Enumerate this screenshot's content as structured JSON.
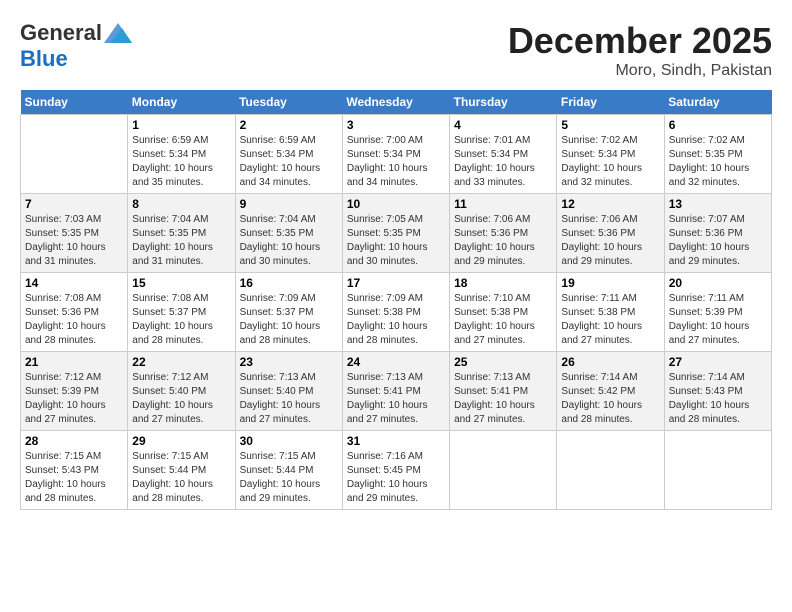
{
  "logo": {
    "general": "General",
    "blue": "Blue"
  },
  "title": "December 2025",
  "subtitle": "Moro, Sindh, Pakistan",
  "days_of_week": [
    "Sunday",
    "Monday",
    "Tuesday",
    "Wednesday",
    "Thursday",
    "Friday",
    "Saturday"
  ],
  "weeks": [
    [
      {
        "day": "",
        "sunrise": "",
        "sunset": "",
        "daylight": ""
      },
      {
        "day": "1",
        "sunrise": "Sunrise: 6:59 AM",
        "sunset": "Sunset: 5:34 PM",
        "daylight": "Daylight: 10 hours and 35 minutes."
      },
      {
        "day": "2",
        "sunrise": "Sunrise: 6:59 AM",
        "sunset": "Sunset: 5:34 PM",
        "daylight": "Daylight: 10 hours and 34 minutes."
      },
      {
        "day": "3",
        "sunrise": "Sunrise: 7:00 AM",
        "sunset": "Sunset: 5:34 PM",
        "daylight": "Daylight: 10 hours and 34 minutes."
      },
      {
        "day": "4",
        "sunrise": "Sunrise: 7:01 AM",
        "sunset": "Sunset: 5:34 PM",
        "daylight": "Daylight: 10 hours and 33 minutes."
      },
      {
        "day": "5",
        "sunrise": "Sunrise: 7:02 AM",
        "sunset": "Sunset: 5:34 PM",
        "daylight": "Daylight: 10 hours and 32 minutes."
      },
      {
        "day": "6",
        "sunrise": "Sunrise: 7:02 AM",
        "sunset": "Sunset: 5:35 PM",
        "daylight": "Daylight: 10 hours and 32 minutes."
      }
    ],
    [
      {
        "day": "7",
        "sunrise": "Sunrise: 7:03 AM",
        "sunset": "Sunset: 5:35 PM",
        "daylight": "Daylight: 10 hours and 31 minutes."
      },
      {
        "day": "8",
        "sunrise": "Sunrise: 7:04 AM",
        "sunset": "Sunset: 5:35 PM",
        "daylight": "Daylight: 10 hours and 31 minutes."
      },
      {
        "day": "9",
        "sunrise": "Sunrise: 7:04 AM",
        "sunset": "Sunset: 5:35 PM",
        "daylight": "Daylight: 10 hours and 30 minutes."
      },
      {
        "day": "10",
        "sunrise": "Sunrise: 7:05 AM",
        "sunset": "Sunset: 5:35 PM",
        "daylight": "Daylight: 10 hours and 30 minutes."
      },
      {
        "day": "11",
        "sunrise": "Sunrise: 7:06 AM",
        "sunset": "Sunset: 5:36 PM",
        "daylight": "Daylight: 10 hours and 29 minutes."
      },
      {
        "day": "12",
        "sunrise": "Sunrise: 7:06 AM",
        "sunset": "Sunset: 5:36 PM",
        "daylight": "Daylight: 10 hours and 29 minutes."
      },
      {
        "day": "13",
        "sunrise": "Sunrise: 7:07 AM",
        "sunset": "Sunset: 5:36 PM",
        "daylight": "Daylight: 10 hours and 29 minutes."
      }
    ],
    [
      {
        "day": "14",
        "sunrise": "Sunrise: 7:08 AM",
        "sunset": "Sunset: 5:36 PM",
        "daylight": "Daylight: 10 hours and 28 minutes."
      },
      {
        "day": "15",
        "sunrise": "Sunrise: 7:08 AM",
        "sunset": "Sunset: 5:37 PM",
        "daylight": "Daylight: 10 hours and 28 minutes."
      },
      {
        "day": "16",
        "sunrise": "Sunrise: 7:09 AM",
        "sunset": "Sunset: 5:37 PM",
        "daylight": "Daylight: 10 hours and 28 minutes."
      },
      {
        "day": "17",
        "sunrise": "Sunrise: 7:09 AM",
        "sunset": "Sunset: 5:38 PM",
        "daylight": "Daylight: 10 hours and 28 minutes."
      },
      {
        "day": "18",
        "sunrise": "Sunrise: 7:10 AM",
        "sunset": "Sunset: 5:38 PM",
        "daylight": "Daylight: 10 hours and 27 minutes."
      },
      {
        "day": "19",
        "sunrise": "Sunrise: 7:11 AM",
        "sunset": "Sunset: 5:38 PM",
        "daylight": "Daylight: 10 hours and 27 minutes."
      },
      {
        "day": "20",
        "sunrise": "Sunrise: 7:11 AM",
        "sunset": "Sunset: 5:39 PM",
        "daylight": "Daylight: 10 hours and 27 minutes."
      }
    ],
    [
      {
        "day": "21",
        "sunrise": "Sunrise: 7:12 AM",
        "sunset": "Sunset: 5:39 PM",
        "daylight": "Daylight: 10 hours and 27 minutes."
      },
      {
        "day": "22",
        "sunrise": "Sunrise: 7:12 AM",
        "sunset": "Sunset: 5:40 PM",
        "daylight": "Daylight: 10 hours and 27 minutes."
      },
      {
        "day": "23",
        "sunrise": "Sunrise: 7:13 AM",
        "sunset": "Sunset: 5:40 PM",
        "daylight": "Daylight: 10 hours and 27 minutes."
      },
      {
        "day": "24",
        "sunrise": "Sunrise: 7:13 AM",
        "sunset": "Sunset: 5:41 PM",
        "daylight": "Daylight: 10 hours and 27 minutes."
      },
      {
        "day": "25",
        "sunrise": "Sunrise: 7:13 AM",
        "sunset": "Sunset: 5:41 PM",
        "daylight": "Daylight: 10 hours and 27 minutes."
      },
      {
        "day": "26",
        "sunrise": "Sunrise: 7:14 AM",
        "sunset": "Sunset: 5:42 PM",
        "daylight": "Daylight: 10 hours and 28 minutes."
      },
      {
        "day": "27",
        "sunrise": "Sunrise: 7:14 AM",
        "sunset": "Sunset: 5:43 PM",
        "daylight": "Daylight: 10 hours and 28 minutes."
      }
    ],
    [
      {
        "day": "28",
        "sunrise": "Sunrise: 7:15 AM",
        "sunset": "Sunset: 5:43 PM",
        "daylight": "Daylight: 10 hours and 28 minutes."
      },
      {
        "day": "29",
        "sunrise": "Sunrise: 7:15 AM",
        "sunset": "Sunset: 5:44 PM",
        "daylight": "Daylight: 10 hours and 28 minutes."
      },
      {
        "day": "30",
        "sunrise": "Sunrise: 7:15 AM",
        "sunset": "Sunset: 5:44 PM",
        "daylight": "Daylight: 10 hours and 29 minutes."
      },
      {
        "day": "31",
        "sunrise": "Sunrise: 7:16 AM",
        "sunset": "Sunset: 5:45 PM",
        "daylight": "Daylight: 10 hours and 29 minutes."
      },
      {
        "day": "",
        "sunrise": "",
        "sunset": "",
        "daylight": ""
      },
      {
        "day": "",
        "sunrise": "",
        "sunset": "",
        "daylight": ""
      },
      {
        "day": "",
        "sunrise": "",
        "sunset": "",
        "daylight": ""
      }
    ]
  ]
}
